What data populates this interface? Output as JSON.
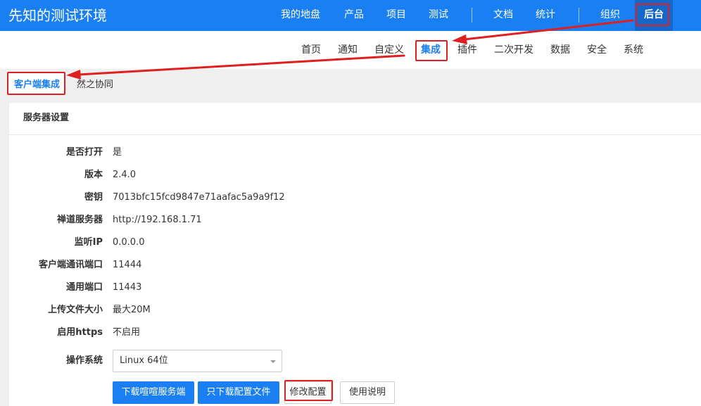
{
  "header": {
    "brand": "先知的测试环境",
    "nav": [
      "我的地盘",
      "产品",
      "项目",
      "测试",
      "文档",
      "统计",
      "组织"
    ],
    "admin_label": "后台"
  },
  "subnav": {
    "items": [
      "首页",
      "通知",
      "自定义",
      "集成",
      "插件",
      "二次开发",
      "数据",
      "安全",
      "系统"
    ],
    "active_index": 3
  },
  "tabs": {
    "items": [
      "客户端集成",
      "然之协同"
    ],
    "active_index": 0
  },
  "panel": {
    "title": "服务器设置",
    "fields": [
      {
        "label": "是否打开",
        "value": "是"
      },
      {
        "label": "版本",
        "value": "2.4.0"
      },
      {
        "label": "密钥",
        "value": "7013bfc15fcd9847e71aafac5a9a9f12"
      },
      {
        "label": "禅道服务器",
        "value": "http://192.168.1.71"
      },
      {
        "label": "监听IP",
        "value": "0.0.0.0"
      },
      {
        "label": "客户端通讯端口",
        "value": "11444"
      },
      {
        "label": "通用端口",
        "value": "11443"
      },
      {
        "label": "上传文件大小",
        "value": "最大20M"
      },
      {
        "label": "启用https",
        "value": "不启用"
      }
    ],
    "os_label": "操作系统",
    "os_value": "Linux 64位",
    "buttons": [
      "下载喧喧服务端",
      "只下载配置文件",
      "修改配置",
      "使用说明"
    ]
  },
  "colors": {
    "primary": "#1a7ff2",
    "highlight": "#e02020",
    "admin_tab_bg": "#1467c8"
  }
}
